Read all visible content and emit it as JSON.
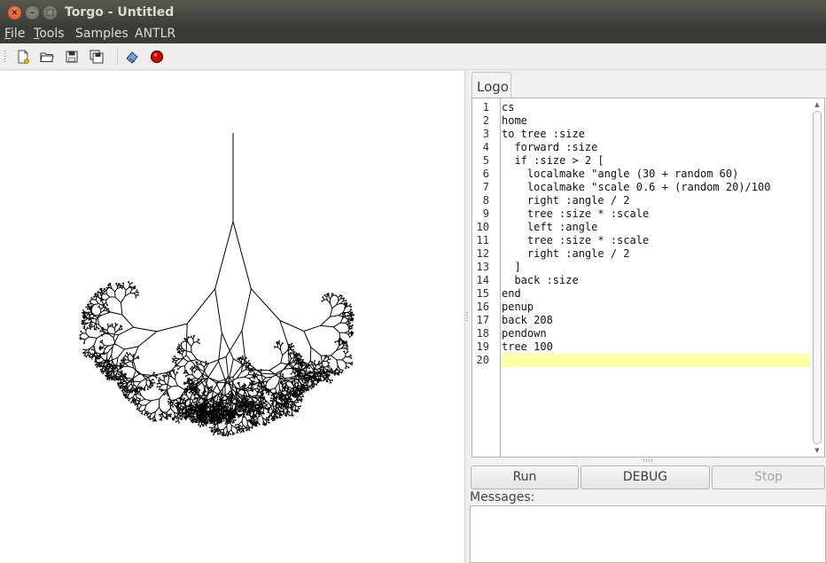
{
  "window": {
    "title": "Torgo - Untitled"
  },
  "menu": {
    "items": [
      {
        "accel": "F",
        "rest": "ile"
      },
      {
        "accel": "T",
        "rest": "ools"
      },
      {
        "accel": "",
        "rest": "Samples"
      },
      {
        "accel": "",
        "rest": "ANTLR"
      }
    ]
  },
  "toolbar": {
    "icons": [
      "new-file-icon",
      "open-folder-icon",
      "save-icon",
      "save-all-icon",
      "clean-icon",
      "record-icon"
    ]
  },
  "tab": {
    "label": "Logo"
  },
  "editor": {
    "lines": [
      "cs",
      "home",
      "to tree :size",
      "  forward :size",
      "  if :size > 2 [",
      "    localmake \"angle (30 + random 60)",
      "    localmake \"scale 0.6 + (random 20)/100",
      "    right :angle / 2",
      "    tree :size * :scale",
      "    left :angle",
      "    tree :size * :scale",
      "    right :angle / 2",
      "  ]",
      "  back :size",
      "end",
      "penup",
      "back 208",
      "pendown",
      "tree 100",
      ""
    ],
    "current_line": 20
  },
  "buttons": {
    "run": "Run",
    "debug": "DEBUG",
    "stop": "Stop"
  },
  "messages": {
    "label": "Messages:",
    "text": ""
  },
  "colors": {
    "titlebar": "#3c3b37",
    "current_line": "#ffffa8",
    "close": "#df4a16",
    "record": "#d10000"
  }
}
